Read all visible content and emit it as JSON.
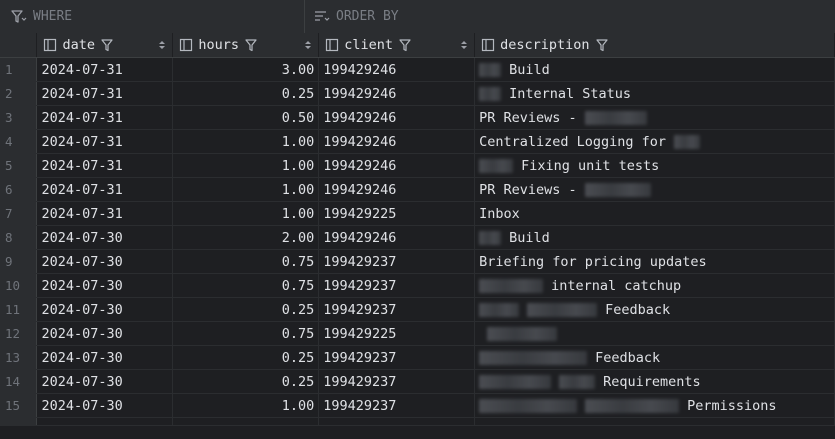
{
  "filter": {
    "where_placeholder": "WHERE",
    "order_placeholder": "ORDER BY"
  },
  "columns": [
    {
      "label": "date"
    },
    {
      "label": "hours"
    },
    {
      "label": "client"
    },
    {
      "label": "description"
    }
  ],
  "rows": [
    {
      "n": "1",
      "date": "2024-07-31",
      "hours": "3.00",
      "client": "199429246",
      "desc_text": "Build",
      "blur_before": [
        22
      ],
      "blur_after": []
    },
    {
      "n": "2",
      "date": "2024-07-31",
      "hours": "0.25",
      "client": "199429246",
      "desc_text": "Internal Status",
      "blur_before": [
        22
      ],
      "blur_after": []
    },
    {
      "n": "3",
      "date": "2024-07-31",
      "hours": "0.50",
      "client": "199429246",
      "desc_text": "PR Reviews -",
      "blur_before": [],
      "blur_after": [
        62
      ]
    },
    {
      "n": "4",
      "date": "2024-07-31",
      "hours": "1.00",
      "client": "199429246",
      "desc_text": "Centralized Logging for",
      "blur_before": [],
      "blur_after": [
        26
      ]
    },
    {
      "n": "5",
      "date": "2024-07-31",
      "hours": "1.00",
      "client": "199429246",
      "desc_text": "Fixing unit tests",
      "blur_before": [
        34
      ],
      "blur_after": []
    },
    {
      "n": "6",
      "date": "2024-07-31",
      "hours": "1.00",
      "client": "199429246",
      "desc_text": "PR Reviews -",
      "blur_before": [],
      "blur_after": [
        66
      ]
    },
    {
      "n": "7",
      "date": "2024-07-31",
      "hours": "1.00",
      "client": "199429225",
      "desc_text": "Inbox",
      "blur_before": [],
      "blur_after": []
    },
    {
      "n": "8",
      "date": "2024-07-30",
      "hours": "2.00",
      "client": "199429246",
      "desc_text": "Build",
      "blur_before": [
        22
      ],
      "blur_after": []
    },
    {
      "n": "9",
      "date": "2024-07-30",
      "hours": "0.75",
      "client": "199429237",
      "desc_text": "Briefing for pricing updates",
      "blur_before": [],
      "blur_after": []
    },
    {
      "n": "10",
      "date": "2024-07-30",
      "hours": "0.75",
      "client": "199429237",
      "desc_text": "internal catchup",
      "blur_before": [
        64
      ],
      "blur_after": []
    },
    {
      "n": "11",
      "date": "2024-07-30",
      "hours": "0.25",
      "client": "199429237",
      "desc_text": "Feedback",
      "blur_before": [
        40,
        70
      ],
      "blur_after": []
    },
    {
      "n": "12",
      "date": "2024-07-30",
      "hours": "0.75",
      "client": "199429225",
      "desc_text": "",
      "blur_before": [],
      "blur_after": [
        70
      ]
    },
    {
      "n": "13",
      "date": "2024-07-30",
      "hours": "0.25",
      "client": "199429237",
      "desc_text": "Feedback",
      "blur_before": [
        108
      ],
      "blur_after": []
    },
    {
      "n": "14",
      "date": "2024-07-30",
      "hours": "0.25",
      "client": "199429237",
      "desc_text": "Requirements",
      "blur_before": [
        72,
        36
      ],
      "blur_after": []
    },
    {
      "n": "15",
      "date": "2024-07-30",
      "hours": "1.00",
      "client": "199429237",
      "desc_text": "Permissions",
      "blur_before": [
        98,
        94
      ],
      "blur_after": []
    }
  ]
}
